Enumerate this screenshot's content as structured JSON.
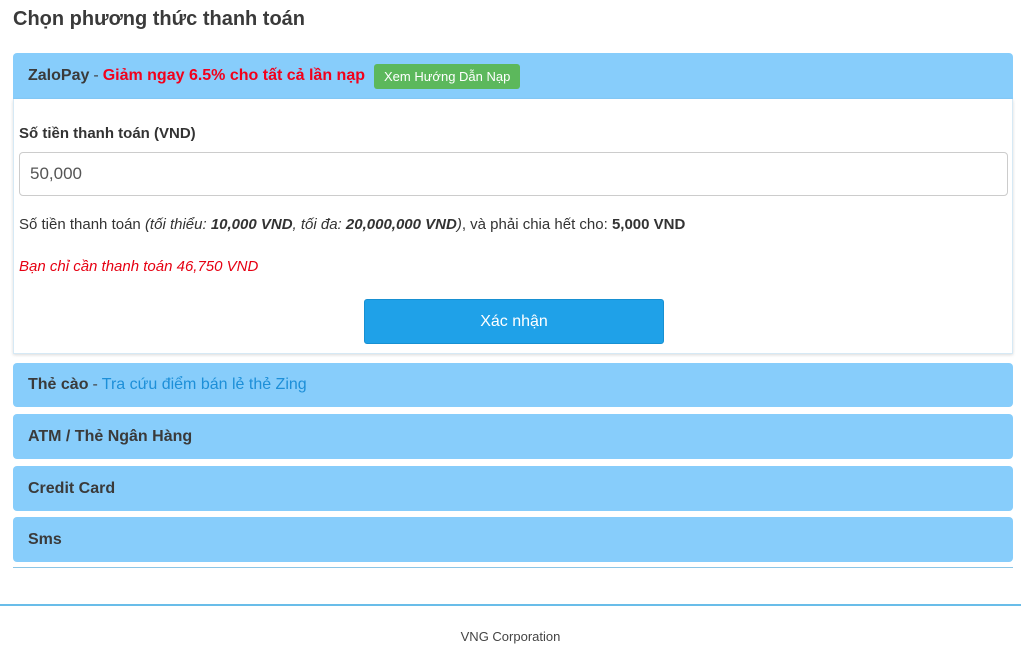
{
  "page_title": "Chọn phương thức thanh toán",
  "zalopay": {
    "name": "ZaloPay",
    "separator": "-",
    "promo": "Giảm ngay 6.5% cho tất cả lần nạp",
    "guide_button": "Xem Hướng Dẫn Nạp",
    "amount_label": "Số tiền thanh toán (VND)",
    "amount_value": "50,000",
    "hint": {
      "prefix": "Số tiền thanh toán",
      "open": "(tối thiểu:",
      "min": "10,000 VND",
      "max_label": ", tối đa:",
      "max": "20,000,000 VND",
      "close": ")",
      "divisible_text": ", và phải chia hết cho:",
      "divisible": "5,000 VND"
    },
    "pay_note": "Bạn chỉ cần thanh toán 46,750 VND",
    "confirm_button": "Xác nhận"
  },
  "methods": {
    "card": {
      "name": "Thẻ cào",
      "separator": "-",
      "link": "Tra cứu điểm bán lẻ thẻ Zing"
    },
    "atm": {
      "name": "ATM / Thẻ Ngân Hàng"
    },
    "credit": {
      "name": "Credit Card"
    },
    "sms": {
      "name": "Sms"
    }
  },
  "footer": {
    "company": "VNG Corporation"
  },
  "colors": {
    "panel_bg": "#87cdfb",
    "promo_red": "#f2001b",
    "guide_green": "#5cb85c",
    "confirm_blue": "#1fa1e8",
    "link_blue": "#1d8fd8"
  }
}
